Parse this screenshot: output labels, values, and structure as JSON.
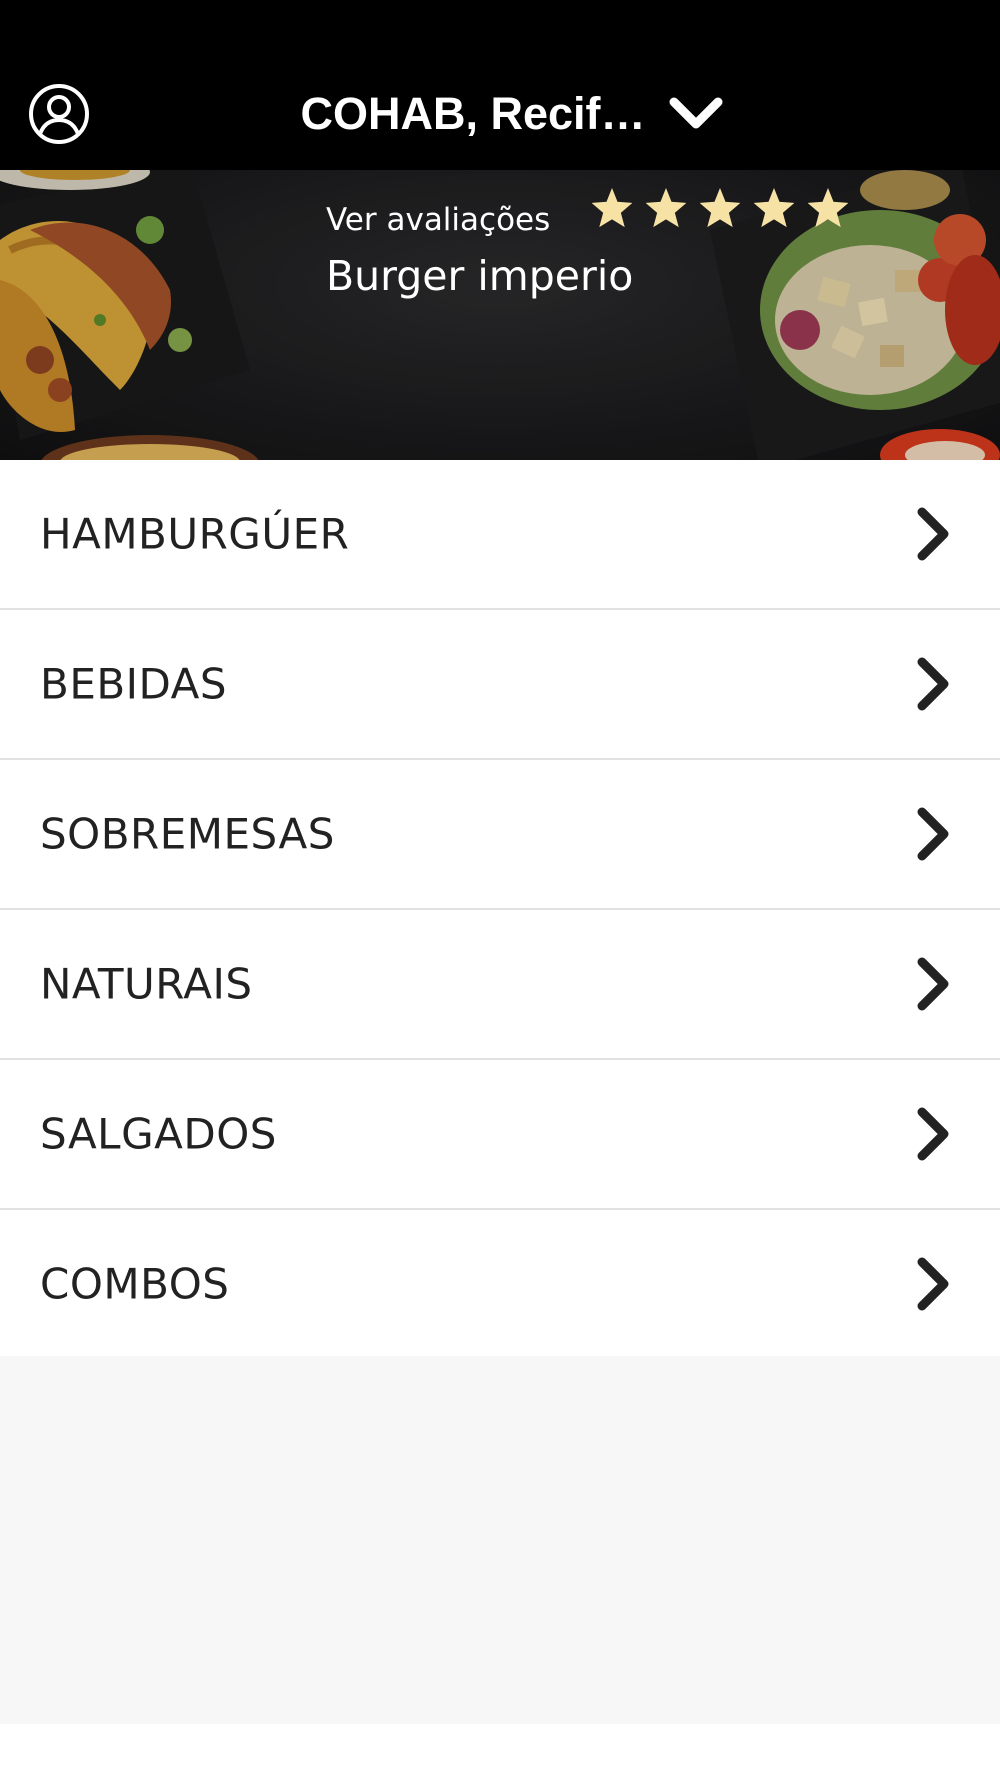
{
  "header": {
    "location_label": "COHAB, Recif…",
    "avatar_icon": "user-circle-icon",
    "dropdown_icon": "chevron-down-icon"
  },
  "store": {
    "reviews_label": "Ver avaliações",
    "name": "Burger imperio",
    "rating": 5,
    "rating_max": 5,
    "star_color": "#f7e2a6"
  },
  "categories": [
    {
      "label": "HAMBURGÚER"
    },
    {
      "label": "BEBIDAS"
    },
    {
      "label": "SOBREMESAS"
    },
    {
      "label": "NATURAIS"
    },
    {
      "label": "SALGADOS"
    },
    {
      "label": "COMBOS"
    }
  ],
  "colors": {
    "topbar": "#000000",
    "text_dark": "#222222",
    "divider": "#e2e2e2",
    "background_empty": "#f7f7f7"
  }
}
